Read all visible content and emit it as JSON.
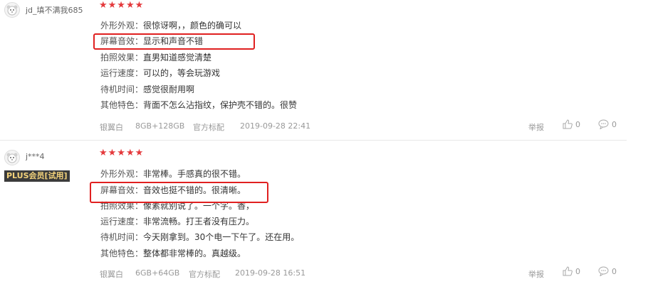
{
  "reviews": [
    {
      "user": "jd_填不满我685",
      "badge": "",
      "stars": "★★★★★",
      "attributes": [
        {
          "key": "外形外观：",
          "value": "很惊讶啊，，颜色的确可以"
        },
        {
          "key": "屏幕音效：",
          "value": "显示和声音不错"
        },
        {
          "key": "拍照效果：",
          "value": "直男知道感觉清楚"
        },
        {
          "key": "运行速度：",
          "value": "可以的，等会玩游戏"
        },
        {
          "key": "待机时间：",
          "value": "感觉很耐用啊"
        },
        {
          "key": "其他特色：",
          "value": "背面不怎么沾指纹，保护壳不错的。很赞"
        }
      ],
      "color": "银翼白",
      "spec": "8GB+128GB",
      "package": "官方标配",
      "date": "2019-09-28 22:41",
      "report": "举报",
      "likes": "0",
      "comments": "0"
    },
    {
      "user": "j***4",
      "badge": "PLUS会员[试用]",
      "stars": "★★★★★",
      "attributes": [
        {
          "key": "外形外观：",
          "value": "非常棒。手感真的很不错。"
        },
        {
          "key": "屏幕音效：",
          "value": "音效也挺不错的。很清晰。"
        },
        {
          "key": "拍照效果：",
          "value": "像素就别说了。一个字。香，"
        },
        {
          "key": "运行速度：",
          "value": "非常流畅。打王者没有压力。"
        },
        {
          "key": "待机时间：",
          "value": "今天刚拿到。30个电一下午了。还在用。"
        },
        {
          "key": "其他特色：",
          "value": "整体都非常棒的。真越级。"
        }
      ],
      "color": "银翼白",
      "spec": "6GB+64GB",
      "package": "官方标配",
      "date": "2019-09-28 16:51",
      "report": "举报",
      "likes": "0",
      "comments": "0"
    }
  ],
  "accent_colors": {
    "stars": "#e4393c",
    "highlight": "#e02020",
    "badge_bg": "#3b3b3b",
    "badge_text": "#f3d27b"
  },
  "icons": [
    "avatar-icon",
    "thumbs-up-icon",
    "comment-icon"
  ]
}
